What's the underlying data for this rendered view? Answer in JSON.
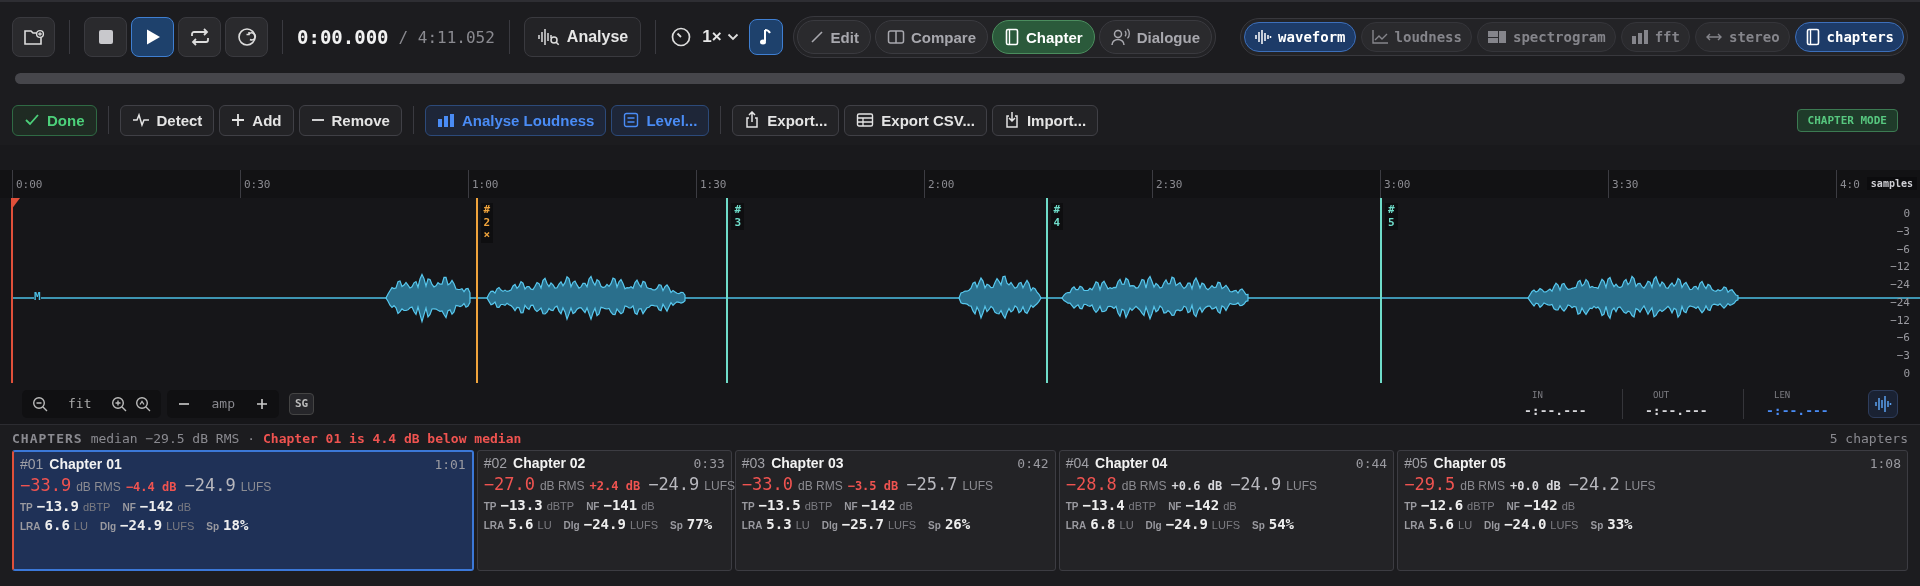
{
  "toolbar": {
    "transport": [
      {
        "active": false
      },
      {
        "active": true
      },
      {
        "active": false
      },
      {
        "active": false
      }
    ],
    "position": "0:00.000",
    "duration": "/ 4:11.052",
    "analyse_button": "Analyse",
    "speed": "1×",
    "pitch_toggle": {
      "active": true
    },
    "modes": [
      {
        "label": "Edit",
        "selected": false
      },
      {
        "label": "Compare",
        "selected": false
      },
      {
        "label": "Chapter",
        "selected": true
      },
      {
        "label": "Dialogue",
        "selected": false
      }
    ],
    "views": [
      {
        "label": "waveform",
        "on": true
      },
      {
        "label": "loudness",
        "on": false
      },
      {
        "label": "spectrogram",
        "on": false
      },
      {
        "label": "fft",
        "on": false
      },
      {
        "label": "stereo",
        "on": false
      },
      {
        "label": "chapters",
        "on": true
      }
    ]
  },
  "chapter_toolbar": {
    "button_groups": [
      [
        {
          "label": "Done",
          "kind": "success"
        }
      ],
      [
        {
          "label": "Detect",
          "kind": "plain"
        },
        {
          "label": "Add",
          "kind": "plain"
        },
        {
          "label": "Remove",
          "kind": "plain"
        }
      ],
      [
        {
          "label": "Analyse Loudness",
          "kind": "info"
        },
        {
          "label": "Level...",
          "kind": "info"
        }
      ],
      [
        {
          "label": "Export...",
          "kind": "plain"
        },
        {
          "label": "Export CSV...",
          "kind": "plain"
        },
        {
          "label": "Import...",
          "kind": "plain"
        }
      ]
    ],
    "mode_badge": "CHAPTER MODE"
  },
  "ruler": {
    "ticks": [
      "0:00",
      "0:30",
      "1:00",
      "1:30",
      "2:00",
      "2:30",
      "3:00",
      "3:30",
      "4:0"
    ],
    "samples_badge": "samples"
  },
  "waveform": {
    "start_label": "M",
    "db_scale": [
      "0",
      "−3",
      "−6",
      "−12",
      "−24",
      "−24",
      "−12",
      "−6",
      "−3",
      "0"
    ],
    "markers": [
      {
        "label": "#2",
        "selected": true,
        "remove": "×"
      },
      {
        "label": "#3",
        "selected": false
      },
      {
        "label": "#4",
        "selected": false
      },
      {
        "label": "#5",
        "selected": false
      }
    ]
  },
  "view_controls": {
    "fit": "fit",
    "amp": "amp",
    "sg_button": "SG",
    "timecodes": [
      {
        "label": "IN",
        "value": "-:--.---",
        "kind": "input"
      },
      {
        "label": "OUT",
        "value": "-:--.---",
        "kind": "input"
      },
      {
        "label": "LEN",
        "value": "-:--.---",
        "kind": "readout"
      }
    ]
  },
  "chapters": {
    "title": "CHAPTERS",
    "summary": "median −29.5 dB RMS ·",
    "warning": "Chapter 01 is 4.4 dB below median",
    "count": "5 chapters",
    "items": [
      {
        "number": "#01",
        "name": "Chapter 01",
        "duration": "1:01",
        "selected": true,
        "rms": "−33.9",
        "rms_unit": "dB RMS",
        "delta": "−4.4 dB",
        "delta_alert": true,
        "lufs": "−24.9",
        "lufs_unit": "LUFS",
        "stats": [
          [
            {
              "label": "TP",
              "value": "−13.9",
              "unit": "dBTP"
            },
            {
              "label": "NF",
              "value": "−142",
              "unit": "dB"
            }
          ],
          [
            {
              "label": "LRA",
              "value": "6.6",
              "unit": "LU"
            },
            {
              "label": "Dlg",
              "value": "−24.9",
              "unit": "LUFS"
            },
            {
              "label": "Sp",
              "value": "18%"
            }
          ]
        ]
      },
      {
        "number": "#02",
        "name": "Chapter 02",
        "duration": "0:33",
        "selected": false,
        "rms": "−27.0",
        "rms_unit": "dB RMS",
        "delta": "+2.4 dB",
        "delta_alert": true,
        "lufs": "−24.9",
        "lufs_unit": "LUFS",
        "stats": [
          [
            {
              "label": "TP",
              "value": "−13.3",
              "unit": "dBTP"
            },
            {
              "label": "NF",
              "value": "−141",
              "unit": "dB"
            }
          ],
          [
            {
              "label": "LRA",
              "value": "5.6",
              "unit": "LU"
            },
            {
              "label": "Dlg",
              "value": "−24.9",
              "unit": "LUFS"
            },
            {
              "label": "Sp",
              "value": "77%"
            }
          ]
        ]
      },
      {
        "number": "#03",
        "name": "Chapter 03",
        "duration": "0:42",
        "selected": false,
        "rms": "−33.0",
        "rms_unit": "dB RMS",
        "delta": "−3.5 dB",
        "delta_alert": true,
        "lufs": "−25.7",
        "lufs_unit": "LUFS",
        "stats": [
          [
            {
              "label": "TP",
              "value": "−13.5",
              "unit": "dBTP"
            },
            {
              "label": "NF",
              "value": "−142",
              "unit": "dB"
            }
          ],
          [
            {
              "label": "LRA",
              "value": "5.3",
              "unit": "LU"
            },
            {
              "label": "Dlg",
              "value": "−25.7",
              "unit": "LUFS"
            },
            {
              "label": "Sp",
              "value": "26%"
            }
          ]
        ]
      },
      {
        "number": "#04",
        "name": "Chapter 04",
        "duration": "0:44",
        "selected": false,
        "rms": "−28.8",
        "rms_unit": "dB RMS",
        "delta": "+0.6 dB",
        "delta_alert": false,
        "lufs": "−24.9",
        "lufs_unit": "LUFS",
        "stats": [
          [
            {
              "label": "TP",
              "value": "−13.4",
              "unit": "dBTP"
            },
            {
              "label": "NF",
              "value": "−142",
              "unit": "dB"
            }
          ],
          [
            {
              "label": "LRA",
              "value": "6.8",
              "unit": "LU"
            },
            {
              "label": "Dlg",
              "value": "−24.9",
              "unit": "LUFS"
            },
            {
              "label": "Sp",
              "value": "54%"
            }
          ]
        ]
      },
      {
        "number": "#05",
        "name": "Chapter 05",
        "duration": "1:08",
        "selected": false,
        "rms": "−29.5",
        "rms_unit": "dB RMS",
        "delta": "+0.0 dB",
        "delta_alert": false,
        "lufs": "−24.2",
        "lufs_unit": "LUFS",
        "stats": [
          [
            {
              "label": "TP",
              "value": "−12.6",
              "unit": "dBTP"
            },
            {
              "label": "NF",
              "value": "−142",
              "unit": "dB"
            }
          ],
          [
            {
              "label": "LRA",
              "value": "5.6",
              "unit": "LU"
            },
            {
              "label": "Dlg",
              "value": "−24.0",
              "unit": "LUFS"
            },
            {
              "label": "Sp",
              "value": "33%"
            }
          ]
        ]
      }
    ]
  }
}
